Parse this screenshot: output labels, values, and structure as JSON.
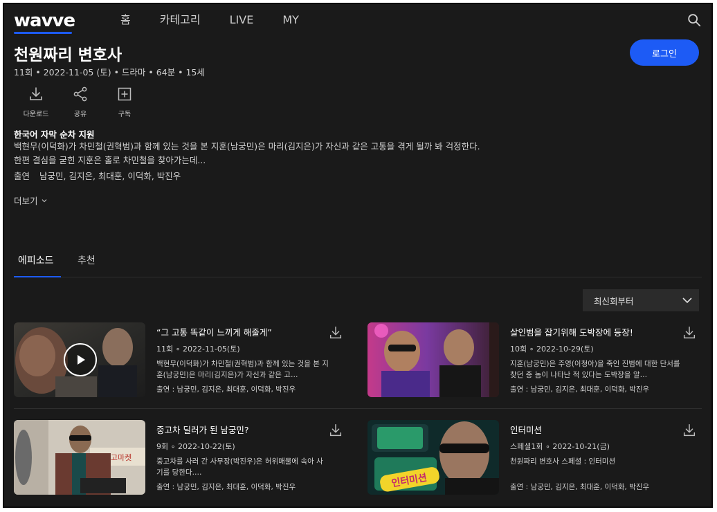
{
  "header": {
    "logo": "wavve",
    "nav": [
      "홈",
      "카테고리",
      "LIVE",
      "MY"
    ]
  },
  "program": {
    "title": "천원짜리 변호사",
    "meta": "11회 • 2022-11-05 (토) • 드라마 • 64분 • 15세",
    "login_label": "로그인",
    "actions": [
      {
        "label": "다운로드",
        "icon": "download-icon"
      },
      {
        "label": "공유",
        "icon": "share-icon"
      },
      {
        "label": "구독",
        "icon": "subscribe-plus-icon"
      }
    ],
    "subtitle_support": "한국어 자막 순차 지원",
    "desc_line1": "백현무(이덕화)가 차민철(권혁범)과 함께 있는 것을 본 지훈(남궁민)은 마리(김지은)가 자신과 같은 고통을 겪게 될까 봐 걱정한다.",
    "desc_line2": "한편 결심을 굳힌 지훈은 홀로 차민철을 찾아가는데...",
    "cast_label": "출연",
    "cast": "남궁민, 김지은, 최대훈, 이덕화, 박진우",
    "more_label": "더보기"
  },
  "tabs": [
    "에피소드",
    "추천"
  ],
  "sort": {
    "selected": "최신회부터"
  },
  "episodes": [
    {
      "title": "“그 고통 똑같이 느끼게 해줄게”",
      "date": "11회 ∘ 2022-11-05(토)",
      "desc": "백현무(이덕화)가 차민철(권혁범)과 함께 있는 것을 본 지훈(남궁민)은 마리(김지은)가 자신과 같은 고…",
      "cast": "출연 : 남궁민, 김지은, 최대훈, 이덕화, 박진우"
    },
    {
      "title": "살인범을 잡기위해 도박장에 등장!",
      "date": "10회 ∘ 2022-10-29(토)",
      "desc": "지훈(남궁민)은 주영(이청아)을 죽인 진범에 대한 단서를 찾던 중 놈이 나타난 적 있다는 도박장을 알…",
      "cast": "출연 : 남궁민, 김지은, 최대훈, 이덕화, 박진우"
    },
    {
      "title": "중고차 딜러가 된 남궁민?",
      "date": "9회 ∘ 2022-10-22(토)",
      "desc": "중고차를 사러 간 사무장(박진우)은 허위매물에 속아 사기를 당한다.…",
      "cast": "출연 : 남궁민, 김지은, 최대훈, 이덕화, 박진우"
    },
    {
      "title": "인터미션",
      "date": "스페셜1회 ∘ 2022-10-21(금)",
      "desc": "천원짜리 변호사 스페셜 : 인터미션",
      "cast": "출연 : 남궁민, 김지은, 최대훈, 이덕화, 박진우"
    }
  ],
  "thumb_texts": {
    "sign": "중고마켓",
    "interm": "인터미션"
  },
  "colors": {
    "accent": "#1d5bf5",
    "background": "#1a1a1a"
  }
}
